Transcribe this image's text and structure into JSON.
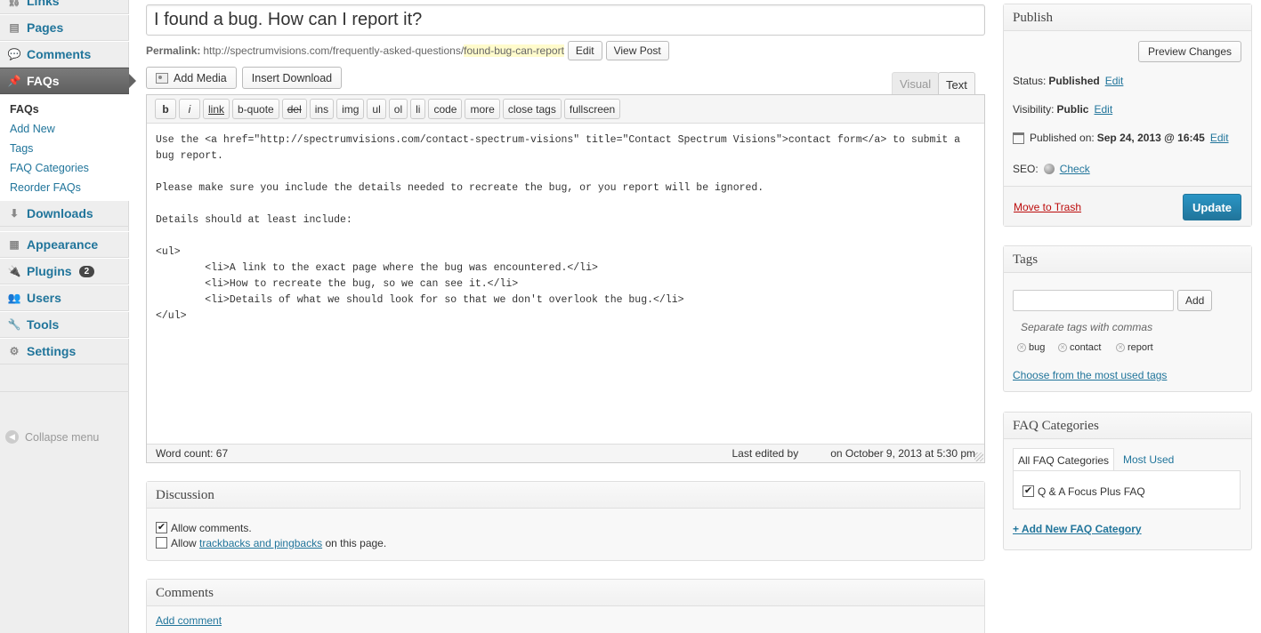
{
  "sidebar": {
    "items": [
      {
        "label": "Links",
        "icon": "links-icon"
      },
      {
        "label": "Pages",
        "icon": "pages-icon"
      },
      {
        "label": "Comments",
        "icon": "comments-icon"
      },
      {
        "label": "FAQs",
        "icon": "pin-icon"
      },
      {
        "label": "Downloads",
        "icon": "downloads-icon"
      },
      {
        "label": "Appearance",
        "icon": "appearance-icon"
      },
      {
        "label": "Plugins",
        "icon": "plugins-icon",
        "badge": "2"
      },
      {
        "label": "Users",
        "icon": "users-icon"
      },
      {
        "label": "Tools",
        "icon": "tools-icon"
      },
      {
        "label": "Settings",
        "icon": "settings-icon"
      }
    ],
    "submenu": [
      "FAQs",
      "Add New",
      "Tags",
      "FAQ Categories",
      "Reorder FAQs"
    ],
    "collapse": "Collapse menu"
  },
  "post": {
    "title": "I found a bug. How can I report it?",
    "permalink_label": "Permalink:",
    "permalink_base": "http://spectrumvisions.com/frequently-asked-questions/",
    "permalink_slug": "found-bug-can-report",
    "edit_label": "Edit",
    "view_label": "View Post"
  },
  "media": {
    "add_media": "Add Media",
    "insert_download": "Insert Download"
  },
  "editor": {
    "tab_visual": "Visual",
    "tab_text": "Text",
    "quicktags": [
      "b",
      "i",
      "link",
      "b-quote",
      "del",
      "ins",
      "img",
      "ul",
      "ol",
      "li",
      "code",
      "more",
      "close tags",
      "fullscreen"
    ],
    "content": "Use the <a href=\"http://spectrumvisions.com/contact-spectrum-visions\" title=\"Contact Spectrum Visions\">contact form</a> to submit a bug report.\n\nPlease make sure you include the details needed to recreate the bug, or you report will be ignored.\n\nDetails should at least include:\n\n<ul>\n        <li>A link to the exact page where the bug was encountered.</li>\n        <li>How to recreate the bug, so we can see it.</li>\n        <li>Details of what we should look for so that we don't overlook the bug.</li>\n</ul>",
    "word_count": "Word count: 67",
    "last_edited_by": "Last edited by",
    "last_edited_on": "on October 9, 2013 at 5:30 pm"
  },
  "discussion": {
    "title": "Discussion",
    "allow_comments": "Allow comments.",
    "allow_prefix": "Allow",
    "trackbacks_link": "trackbacks and pingbacks",
    "allow_suffix": "on this page."
  },
  "comments": {
    "title": "Comments",
    "add_comment": "Add comment"
  },
  "publish": {
    "title": "Publish",
    "preview": "Preview Changes",
    "status_label": "Status:",
    "status_value": "Published",
    "visibility_label": "Visibility:",
    "visibility_value": "Public",
    "published_label": "Published on:",
    "published_value": "Sep 24, 2013 @ 16:45",
    "seo_label": "SEO:",
    "seo_check": "Check",
    "edit": "Edit",
    "trash": "Move to Trash",
    "update": "Update"
  },
  "tags": {
    "title": "Tags",
    "add": "Add",
    "hint": "Separate tags with commas",
    "list": [
      "bug",
      "contact",
      "report"
    ],
    "choose": "Choose from the most used tags"
  },
  "faq_categories": {
    "title": "FAQ Categories",
    "tab_all": "All FAQ Categories",
    "tab_most": "Most Used",
    "item": "Q & A Focus Plus FAQ",
    "add_new": "+ Add New FAQ Category"
  },
  "colors": {
    "link": "#21759b",
    "active_menu": "#6d6d6d",
    "update_button": "#21759b",
    "trash": "#bc0b0b",
    "slug_highlight": "#fffbcc"
  }
}
